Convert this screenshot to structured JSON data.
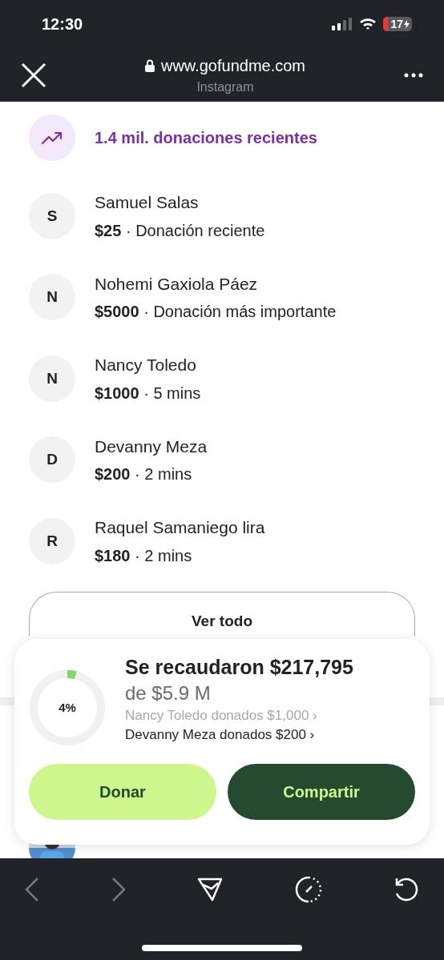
{
  "status_bar": {
    "time": "12:30",
    "battery": "17"
  },
  "browser": {
    "url": "www.gofundme.com",
    "source": "Instagram"
  },
  "trending": {
    "label": "1.4 mil. donaciones recientes"
  },
  "donations": [
    {
      "initial": "S",
      "name": "Samuel Salas",
      "amount": "$25",
      "separator": "·",
      "note": "Donación reciente"
    },
    {
      "initial": "N",
      "name": "Nohemi Gaxiola Páez",
      "amount": "$5000",
      "separator": "·",
      "note": "Donación más importante"
    },
    {
      "initial": "N",
      "name": "Nancy Toledo",
      "amount": "$1000",
      "separator": "·",
      "note": "5 mins"
    },
    {
      "initial": "D",
      "name": "Devanny Meza",
      "amount": "$200",
      "separator": "·",
      "note": "2 mins"
    },
    {
      "initial": "R",
      "name": "Raquel Samaniego lira",
      "amount": "$180",
      "separator": "·",
      "note": "2 mins"
    }
  ],
  "see_all": "Ver todo",
  "summary": {
    "percent": "4%",
    "level": 0.04,
    "raised": "Se recaudaron $217,795",
    "goal": "de $5.9 M",
    "ticker": [
      {
        "text": "Nancy Toledo donados $1,000 ›",
        "kind": "fading"
      },
      {
        "text": "Devanny Meza donados $200 ›",
        "kind": "current"
      }
    ],
    "buttons": [
      {
        "label": "Donar",
        "kind": "primary"
      },
      {
        "label": "Compartir",
        "kind": "secondary"
      }
    ]
  }
}
